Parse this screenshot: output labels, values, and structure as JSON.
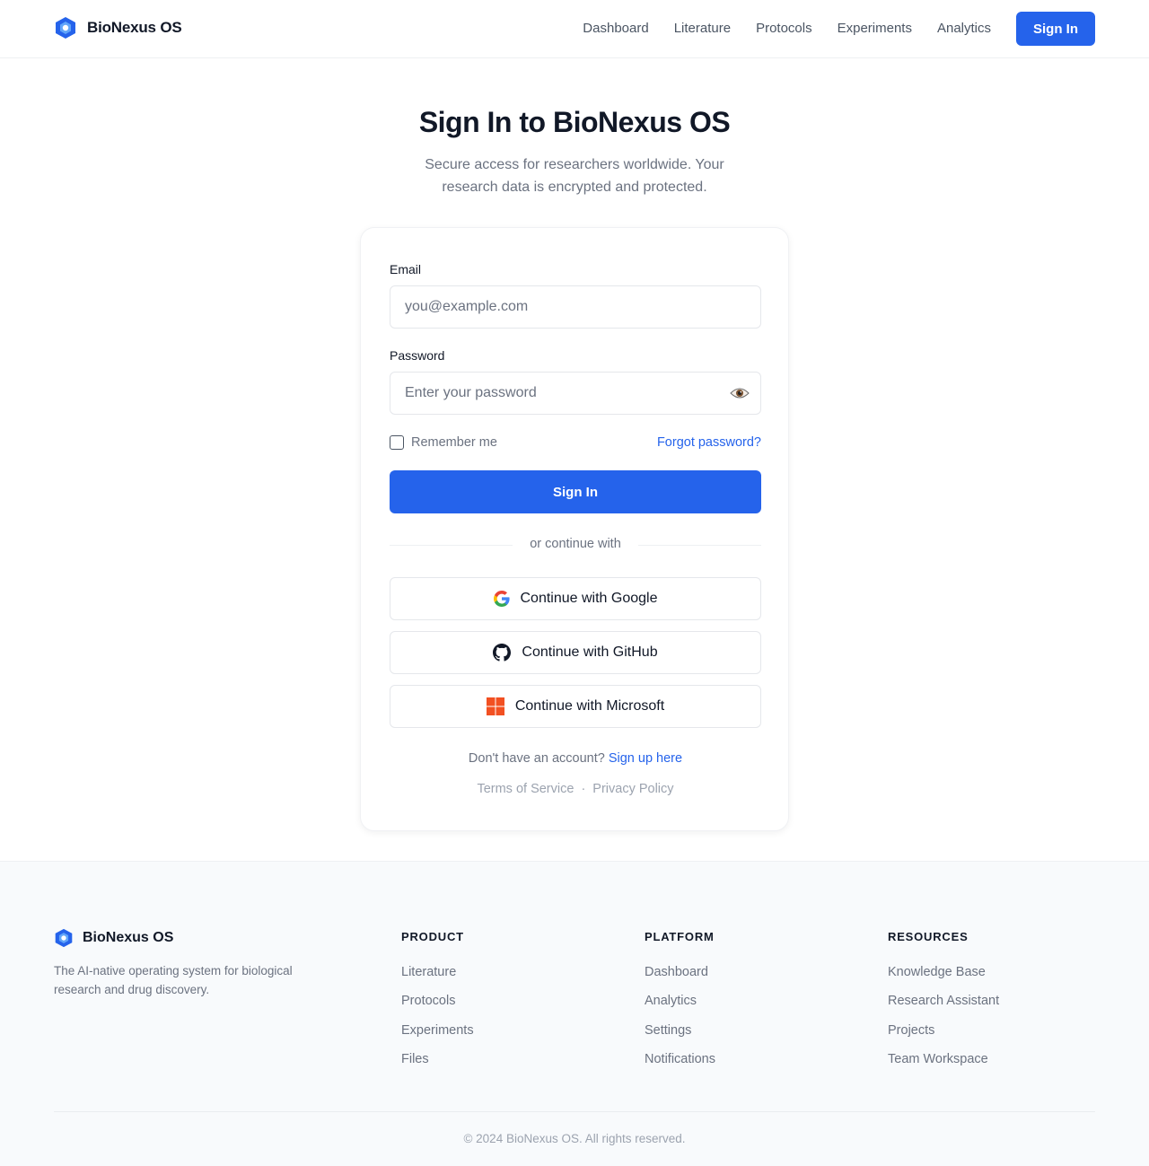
{
  "app": {
    "name": "BioNexus OS"
  },
  "colors": {
    "primary": "#2563eb",
    "text": "#111827",
    "muted": "#6b7280",
    "footer_bg": "#f8fafc"
  },
  "nav": {
    "links": [
      "Dashboard",
      "Literature",
      "Protocols",
      "Experiments",
      "Analytics"
    ],
    "sign_in_label": "Sign In"
  },
  "hero": {
    "title": "Sign In to BioNexus OS",
    "subtitle": "Secure access for researchers worldwide. Your research data is encrypted and protected."
  },
  "form": {
    "email_label": "Email",
    "email_placeholder": "you@example.com",
    "email_value": "",
    "password_label": "Password",
    "password_placeholder": "Enter your password",
    "password_value": "",
    "password_toggle_icon": "eye-icon",
    "remember_label": "Remember me",
    "remember_checked": false,
    "forgot_label": "Forgot password?",
    "submit_label": "Sign In",
    "divider_text": "or continue with",
    "oauth": [
      {
        "label": "Continue with Google",
        "icon": "google-icon"
      },
      {
        "label": "Continue with GitHub",
        "icon": "github-icon"
      },
      {
        "label": "Continue with Microsoft",
        "icon": "microsoft-icon"
      }
    ],
    "signup_prompt": "Don't have an account?",
    "signup_link": "Sign up here",
    "terms_label": "Terms of Service",
    "legal_separator": "·",
    "privacy_label": "Privacy Policy"
  },
  "footer": {
    "brand": "BioNexus OS",
    "description": "The AI-native operating system for biological research and drug discovery.",
    "columns": [
      {
        "title": "PRODUCT",
        "links": [
          "Literature",
          "Protocols",
          "Experiments",
          "Files"
        ]
      },
      {
        "title": "PLATFORM",
        "links": [
          "Dashboard",
          "Analytics",
          "Settings",
          "Notifications"
        ]
      },
      {
        "title": "RESOURCES",
        "links": [
          "Knowledge Base",
          "Research Assistant",
          "Projects",
          "Team Workspace"
        ]
      }
    ],
    "copyright": "© 2024 BioNexus OS. All rights reserved."
  }
}
